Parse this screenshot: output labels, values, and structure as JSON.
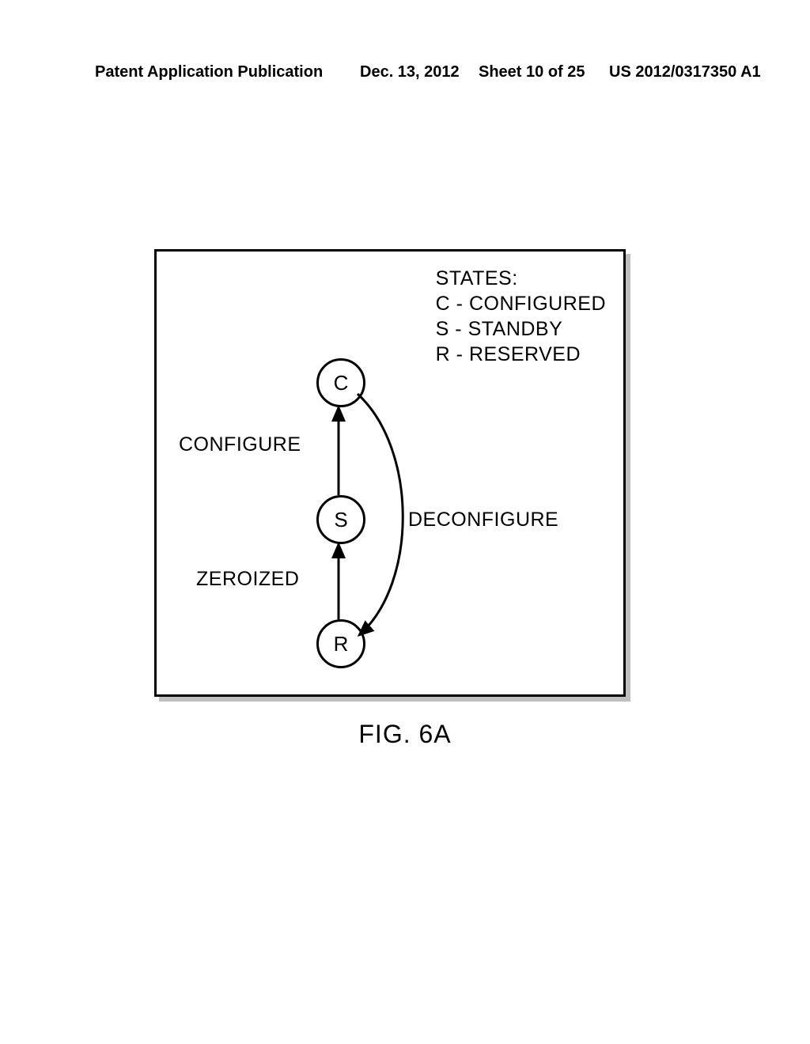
{
  "header": {
    "publication": "Patent Application Publication",
    "date": "Dec. 13, 2012",
    "sheet": "Sheet 10 of 25",
    "appnum": "US 2012/0317350 A1"
  },
  "diagram": {
    "legend": {
      "title": "STATES:",
      "c": "C - CONFIGURED",
      "s": "S - STANDBY",
      "r": "R - RESERVED"
    },
    "nodes": {
      "c": "C",
      "s": "S",
      "r": "R"
    },
    "edges": {
      "configure": "CONFIGURE",
      "deconfigure": "DECONFIGURE",
      "zeroized": "ZEROIZED"
    }
  },
  "figure_label": "FIG. 6A"
}
